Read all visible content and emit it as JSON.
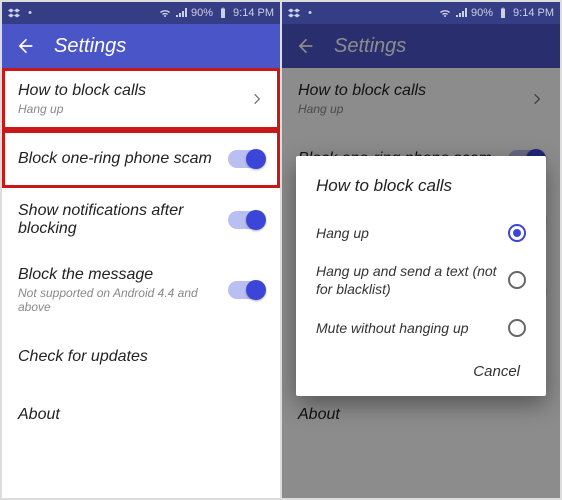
{
  "statusbar": {
    "battery_pct": "90%",
    "time": "9:14 PM"
  },
  "appbar": {
    "title": "Settings"
  },
  "settings": {
    "items": [
      {
        "title": "How to block calls",
        "sub": "Hang up",
        "type": "nav"
      },
      {
        "title": "Block one-ring phone scam",
        "type": "toggle",
        "on": true
      },
      {
        "title": "Show notifications after blocking",
        "type": "toggle",
        "on": true
      },
      {
        "title": "Block the message",
        "sub": "Not supported on Android 4.4 and above",
        "type": "toggle",
        "on": true
      },
      {
        "title": "Check for updates",
        "type": "plain"
      },
      {
        "title": "About",
        "type": "plain"
      }
    ]
  },
  "dialog": {
    "title": "How to block calls",
    "options": [
      {
        "label": "Hang up",
        "checked": true
      },
      {
        "label": "Hang up and send a text (not for blacklist)",
        "checked": false
      },
      {
        "label": "Mute without hanging up",
        "checked": false
      }
    ],
    "cancel": "Cancel"
  }
}
